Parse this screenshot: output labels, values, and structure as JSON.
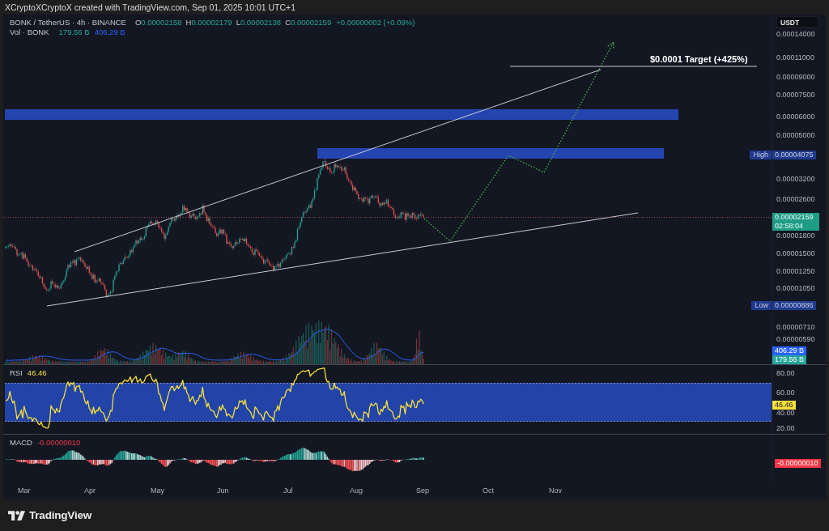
{
  "attribution": "XCryptoXCryptoX created with TradingView.com, Sep 01, 2025 10:01 UTC+1",
  "legend": {
    "symbol": "BONK / TetherUS · 4h · BINANCE",
    "ohlc": [
      {
        "label": "O",
        "value": "0.00002158"
      },
      {
        "label": "H",
        "value": "0.00002179"
      },
      {
        "label": "L",
        "value": "0.00002138"
      },
      {
        "label": "C",
        "value": "0.00002159"
      }
    ],
    "change": "+0.00000002 (+0.09%)",
    "volume": {
      "label": "Vol · BONK",
      "values": [
        {
          "text": "179.56 B",
          "color": "#26a69a"
        },
        {
          "text": "406.29 B",
          "color": "#2962ff"
        }
      ]
    }
  },
  "price_pane": {
    "target_label": "$0.0001 Target (+425%)",
    "high_tag": "High",
    "low_tag": "Low"
  },
  "price_axis": {
    "currency": "USDT",
    "ticks": [
      "0.00014000",
      "0.00011000",
      "0.00009000",
      "0.00007500",
      "0.00006000",
      "0.00005000",
      "0.00003200",
      "0.00002600",
      "0.00001800",
      "0.00001500",
      "0.00001250",
      "0.00001050",
      "0.00000710",
      "0.00000590"
    ],
    "high": "0.00004075",
    "low": "0.00000886",
    "last_price": "0.00002159",
    "countdown": "02:58:04",
    "volume_tags": [
      {
        "text": "406.29 B",
        "color": "#2962ff"
      },
      {
        "text": "179.56 B",
        "color": "#26a69a"
      }
    ]
  },
  "rsi": {
    "label": "RSI",
    "value": "46.46",
    "ticks": [
      "80.00",
      "60.00",
      "40.00",
      "20.00"
    ],
    "value_tag": "46.46"
  },
  "macd": {
    "label": "MACD",
    "value": "-0.00000010",
    "value_tag": "-0.00000010"
  },
  "time_axis": [
    "Mar",
    "Apr",
    "May",
    "Jun",
    "Jul",
    "Aug",
    "Sep",
    "Oct",
    "Nov"
  ],
  "footer": {
    "brand": "TradingView"
  }
}
